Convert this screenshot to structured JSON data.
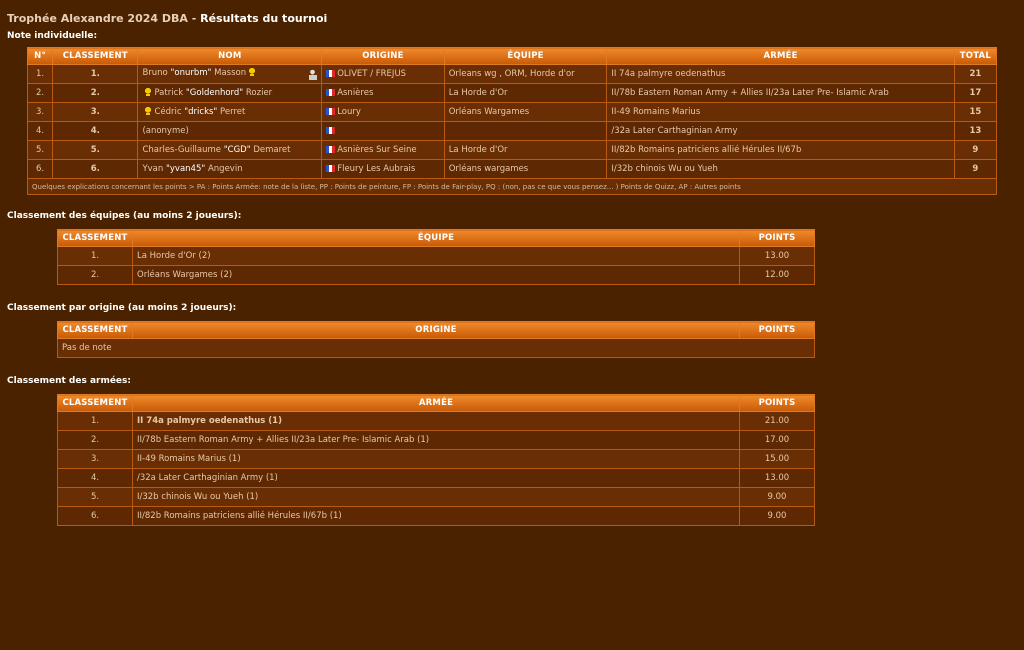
{
  "title": {
    "main": "Trophée Alexandre 2024 DBA",
    "sep": " - ",
    "sub": "Résultats du tournoi"
  },
  "individual": {
    "section": "Note individuelle:",
    "headers": [
      "N°",
      "Classement",
      "Nom",
      "Origine",
      "Équipe",
      "Armée",
      "Total"
    ],
    "rows": [
      {
        "n": "1.",
        "rank": "1.",
        "first": "Bruno ",
        "nick": "\"onurbm\"",
        "last": " Masson",
        "trophy_after": true,
        "pawn": true,
        "origin": "OLIVET / FREJUS",
        "team": "Orleans wg , ORM, Horde d'or",
        "army": "II 74a palmyre oedenathus",
        "total": "21"
      },
      {
        "n": "2.",
        "rank": "2.",
        "first": "Patrick ",
        "nick": "\"Goldenhord\"",
        "last": " Rozier",
        "trophy_before": true,
        "origin": "Asnières",
        "team": "La Horde d'Or",
        "army": "II/78b Eastern Roman Army + Allies II/23a Later Pre- Islamic Arab",
        "total": "17"
      },
      {
        "n": "3.",
        "rank": "3.",
        "first": "Cédric ",
        "nick": "\"dricks\"",
        "last": " Perret",
        "trophy_before": true,
        "origin": "Loury",
        "team": "Orléans Wargames",
        "army": "II-49 Romains Marius",
        "total": "15"
      },
      {
        "n": "4.",
        "rank": "4.",
        "first": "(anonyme)",
        "nick": "",
        "last": "",
        "origin": "",
        "team": "",
        "army": "/32a Later Carthaginian Army",
        "total": "13"
      },
      {
        "n": "5.",
        "rank": "5.",
        "first": "Charles-Guillaume ",
        "nick": "\"CGD\"",
        "last": " Demaret",
        "origin": "Asnières Sur Seine",
        "team": "La Horde d'Or",
        "army": "II/82b Romains patriciens allié Hérules II/67b",
        "total": "9"
      },
      {
        "n": "6.",
        "rank": "6.",
        "first": "Yvan ",
        "nick": "\"yvan45\"",
        "last": " Angevin",
        "origin": "Fleury Les Aubrais",
        "team": "Orléans wargames",
        "army": "I/32b chinois Wu ou Yueh",
        "total": "9"
      }
    ],
    "footnote": "Quelques explications concernant les points > PA : Points Armée: note de la liste, PP : Points de peinture, FP : Points de Fair-play, PQ : (non, pas ce que vous pensez... ) Points de Quizz, AP : Autres points"
  },
  "teams": {
    "section": "Classement des équipes (au moins 2 joueurs):",
    "headers": [
      "Classement",
      "Équipe",
      "Points"
    ],
    "rows": [
      {
        "rank": "1.",
        "name": "La Horde d'Or (2)",
        "points": "13.00"
      },
      {
        "rank": "2.",
        "name": "Orléans Wargames (2)",
        "points": "12.00"
      }
    ]
  },
  "origins": {
    "section": "Classement par origine (au moins 2 joueurs):",
    "headers": [
      "Classement",
      "Origine",
      "Points"
    ],
    "empty": "Pas de note"
  },
  "armies": {
    "section": "Classement des armées:",
    "headers": [
      "Classement",
      "Armée",
      "Points"
    ],
    "rows": [
      {
        "rank": "1.",
        "name": "II 74a palmyre oedenathus (1)",
        "points": "21.00",
        "bold": true
      },
      {
        "rank": "2.",
        "name": "II/78b Eastern Roman Army + Allies II/23a Later Pre- Islamic Arab (1)",
        "points": "17.00"
      },
      {
        "rank": "3.",
        "name": "II-49 Romains Marius (1)",
        "points": "15.00"
      },
      {
        "rank": "4.",
        "name": "/32a Later Carthaginian Army (1)",
        "points": "13.00"
      },
      {
        "rank": "5.",
        "name": "I/32b chinois Wu ou Yueh (1)",
        "points": "9.00"
      },
      {
        "rank": "6.",
        "name": "II/82b Romains patriciens allié Hérules II/67b (1)",
        "points": "9.00"
      }
    ]
  }
}
